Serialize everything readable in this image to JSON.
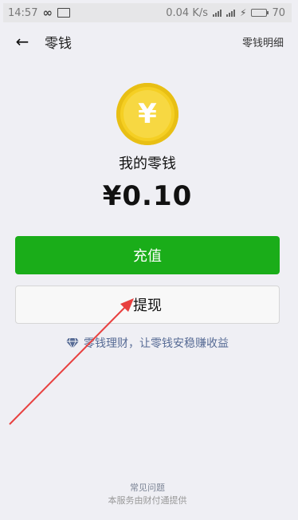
{
  "status_bar": {
    "time": "14:57",
    "infinity_icon": "∞",
    "network_speed": "0.04 K/s",
    "battery_level": "70"
  },
  "header": {
    "title": "零钱",
    "detail_link": "零钱明细"
  },
  "wallet": {
    "coin_symbol": "¥",
    "label": "我的零钱",
    "amount": "¥0.10"
  },
  "actions": {
    "recharge_label": "充值",
    "withdraw_label": "提现"
  },
  "promo": {
    "text": "零钱理财，让零钱安稳赚收益"
  },
  "footer": {
    "faq": "常见问题",
    "provider": "本服务由财付通提供"
  },
  "colors": {
    "background": "#efeff4",
    "primary_green": "#1aad19",
    "coin_yellow": "#f5cf23",
    "link_blue": "#576b95",
    "annotation_red": "#e8403f"
  },
  "icons": {
    "back": "arrow-left-icon",
    "coin": "yuan-coin-icon",
    "promo": "diamond-icon"
  }
}
